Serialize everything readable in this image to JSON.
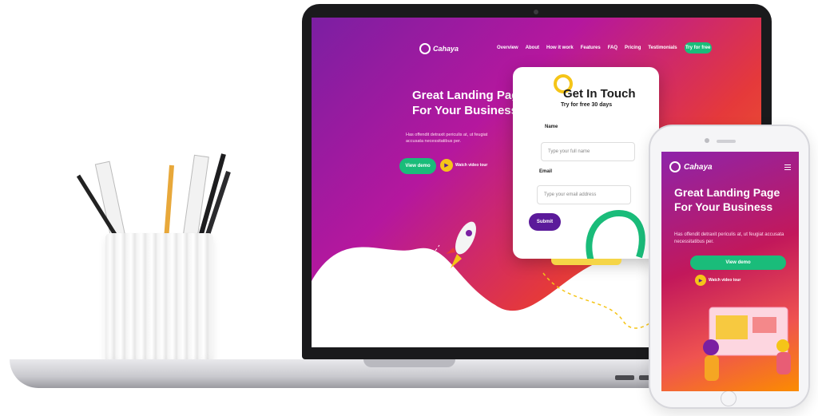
{
  "brand": "Cahaya",
  "nav": {
    "items": [
      "Overview",
      "About",
      "How it work",
      "Features",
      "FAQ",
      "Pricing",
      "Testimonials"
    ],
    "cta_label": "Try for free"
  },
  "hero": {
    "title_line1": "Great Landing Page",
    "title_line2": "For Your Business",
    "subtitle": "Has offendit detraxit periculis at, ut feugiat accusata necessitatibus per.",
    "primary_label": "View demo",
    "video_label": "Watch video tour"
  },
  "form": {
    "title": "Get In Touch",
    "subtitle": "Try for free 30 days",
    "name_label": "Name",
    "name_placeholder": "Type your full name",
    "email_label": "Email",
    "email_placeholder": "Type your email address",
    "submit_label": "Submit"
  },
  "mobile": {
    "title": "Great Landing Page For Your Business",
    "subtitle": "Has offendit detraxit periculis at, ut feugiat accusata necessitatibus per.",
    "primary_label": "View demo",
    "video_label": "Watch video tour"
  },
  "colors": {
    "accent_green": "#1abc7a",
    "submit_purple": "#5b1a9a",
    "ring_yellow": "#f5c518"
  }
}
